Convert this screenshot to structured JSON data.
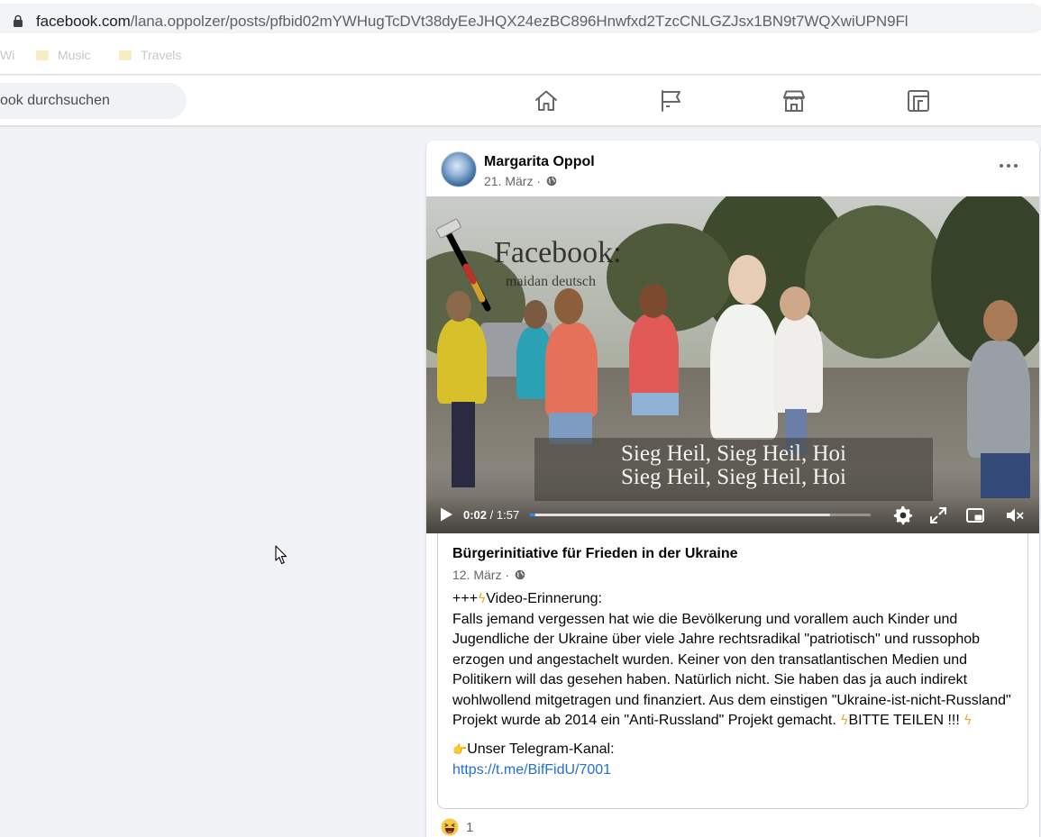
{
  "browser": {
    "url_domain": "facebook.com",
    "url_path": "/lana.oppolzer/posts/pfbid02mYWHugTcDVt38dyEeJHQX24ezBC896Hnwfxd2TzcCNLGZJsx1BN9t7WQXwiUPN9Fl",
    "bookmarks": [
      {
        "label": "Wi",
        "icon": ""
      },
      {
        "label": "Music",
        "icon": "folder-icon"
      },
      {
        "label": "Travels",
        "icon": "folder-icon"
      }
    ]
  },
  "header": {
    "search_placeholder": "ook durchsuchen",
    "nav_icons": [
      "home-icon",
      "pages-flag-icon",
      "marketplace-store-icon",
      "gaming-icon"
    ]
  },
  "post": {
    "author": "Margarita Oppol",
    "date": "21. März",
    "privacy_sep": "·",
    "video": {
      "watermark_title": "Facebook:",
      "watermark_sub": "maidan deutsch",
      "subtitle_line1": "Sieg Heil, Sieg Heil, Hoi",
      "subtitle_line2": "Sieg Heil, Sieg Heil, Hoi",
      "current_time": "0:02",
      "time_sep": " / ",
      "duration": "1:57",
      "played_fraction": 0.017,
      "buffered_fraction": 0.88
    },
    "shared": {
      "author": "Bürgerinitiative für Frieden in der Ukraine",
      "date": "12. März",
      "privacy_sep": "·",
      "line1_prefix": "+++",
      "lightning": "ϟ",
      "line1_text": "Video-Erinnerung:",
      "body": "Falls jemand vergessen hat wie die Bevölkerung und vorallem auch Kinder und Jugendliche der Ukraine über viele Jahre rechtsradikal \"patriotisch\" und russophob erzogen und angestachelt wurden. Keiner von den transatlantischen Medien und Politikern will das gesehen haben. Natürlich nicht. Sie haben das ja auch indirekt wohlwollend mitgetragen und finanziert. Aus dem einstigen \"Ukraine-ist-nicht-Russland\" Projekt wurde ab 2014 ein \"Anti-Russland\" Projekt gemacht. ",
      "body_end": "BITTE TEILEN !!! ",
      "pointing_hand": "👉",
      "telegram_label": "Unser Telegram-Kanal:",
      "telegram_link": "https://t.me/BifFidU/7001"
    },
    "reactions": {
      "icon": "haha-reaction-icon",
      "count": "1"
    }
  },
  "colors": {
    "fb_blue": "#216fdb",
    "page_bg": "#f0f2f5",
    "progress": "#2d88ff"
  }
}
